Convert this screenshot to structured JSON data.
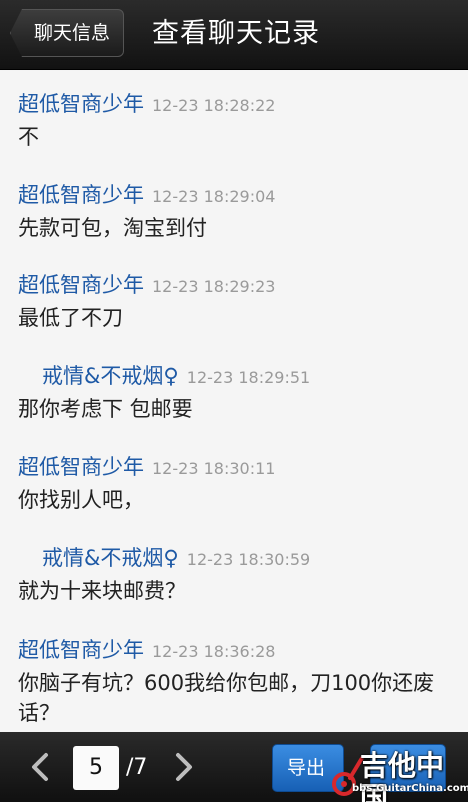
{
  "header": {
    "back_label": "聊天信息",
    "title": "查看聊天记录"
  },
  "messages": [
    {
      "sender": "超低智商少年",
      "time": "12-23 18:28:22",
      "text": "不",
      "side": "other"
    },
    {
      "sender": "超低智商少年",
      "time": "12-23 18:29:04",
      "text": "先款可包，淘宝到付",
      "side": "other"
    },
    {
      "sender": "超低智商少年",
      "time": "12-23 18:29:23",
      "text": "最低了不刀",
      "side": "other"
    },
    {
      "sender": "戒情&不戒烟♀",
      "time": "12-23 18:29:51",
      "text": "那你考虑下 包邮要",
      "side": "self"
    },
    {
      "sender": "超低智商少年",
      "time": "12-23 18:30:11",
      "text": "你找别人吧，",
      "side": "other"
    },
    {
      "sender": "戒情&不戒烟♀",
      "time": "12-23 18:30:59",
      "text": "就为十来块邮费？",
      "side": "self"
    },
    {
      "sender": "超低智商少年",
      "time": "12-23 18:36:28",
      "text": "你脑子有坑？600我给你包邮，刀100你还废话？",
      "side": "other"
    }
  ],
  "footer": {
    "current_page": "5",
    "total_pages": "/7",
    "export_label": "导出"
  },
  "watermark": {
    "title": "吉他中国",
    "url": "bbs.GuitarChina.com"
  },
  "colors": {
    "sender": "#1f5aa6",
    "time": "#9a9a9a",
    "button_blue": "#2a78cf",
    "watermark_red": "#d8282c"
  },
  "icons": {
    "prev": "chevron-left-icon",
    "next": "chevron-right-icon"
  }
}
